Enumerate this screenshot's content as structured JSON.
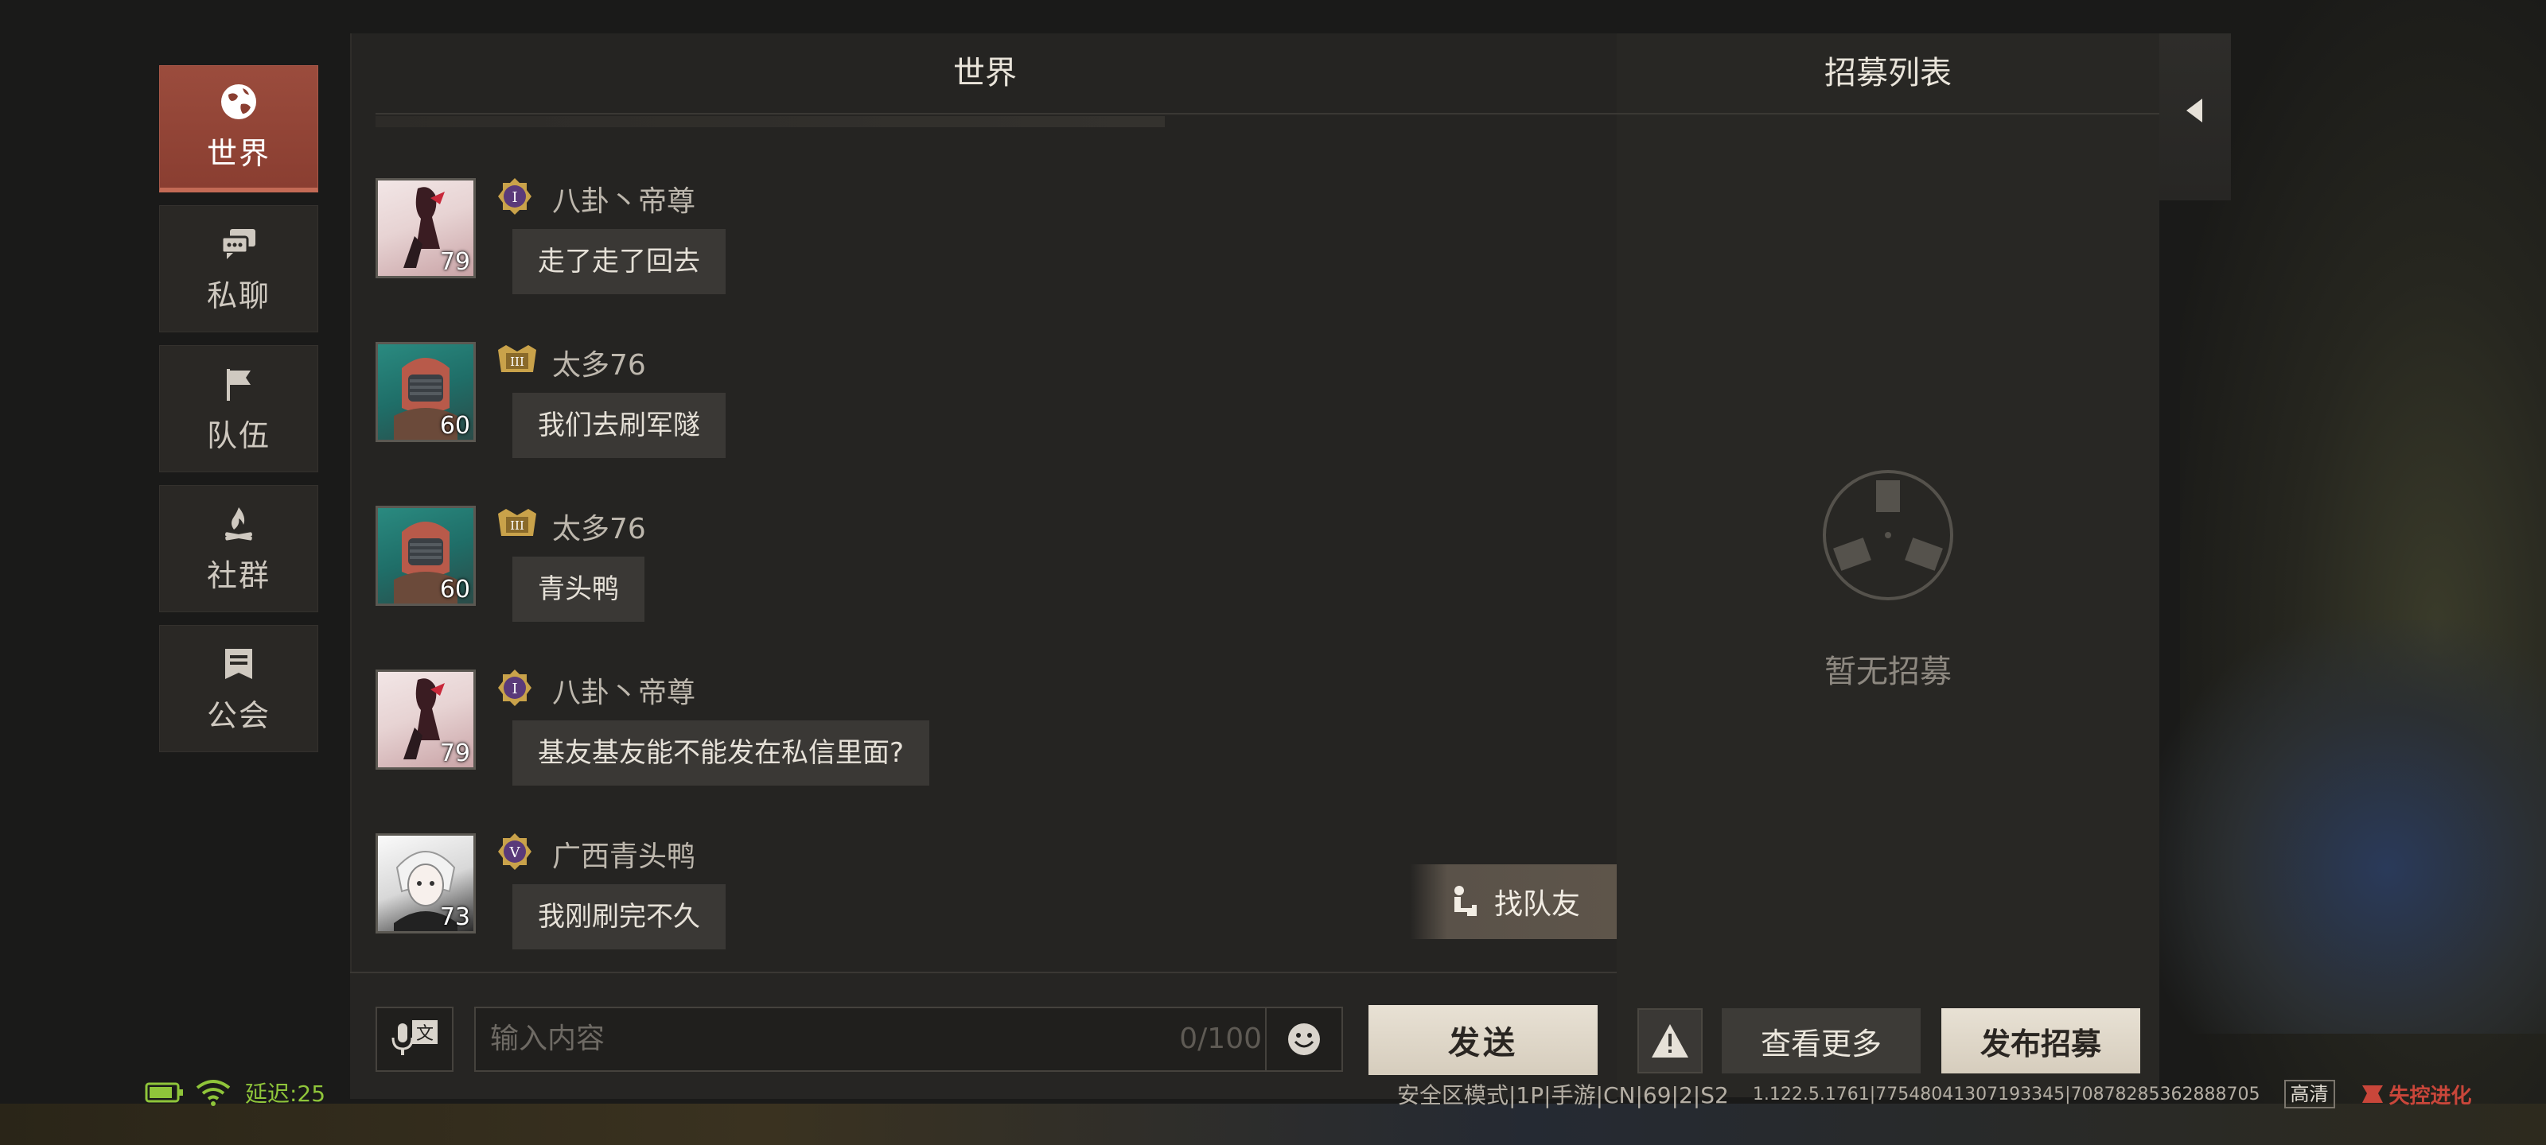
{
  "nav": {
    "items": [
      {
        "label": "世界",
        "icon": "globe-icon",
        "active": true
      },
      {
        "label": "私聊",
        "icon": "chat-bubbles-icon",
        "active": false
      },
      {
        "label": "队伍",
        "icon": "flag-icon",
        "active": false
      },
      {
        "label": "社群",
        "icon": "campfire-icon",
        "active": false
      },
      {
        "label": "公会",
        "icon": "guild-banner-icon",
        "active": false
      }
    ]
  },
  "chat": {
    "title": "世界",
    "messages": [
      {
        "user": "八卦丶帝尊",
        "level": "79",
        "badge": "I",
        "text": "走了走了回去"
      },
      {
        "user": "太多76",
        "level": "60",
        "badge": "III",
        "text": "我们去刷军隧"
      },
      {
        "user": "太多76",
        "level": "60",
        "badge": "III",
        "text": "青头鸭"
      },
      {
        "user": "八卦丶帝尊",
        "level": "79",
        "badge": "I",
        "text": "基友基友能不能发在私信里面?"
      },
      {
        "user": "广西青头鸭",
        "level": "73",
        "badge": "V",
        "text": "我刚刷完不久"
      }
    ],
    "find_teammate_label": "找队友",
    "input": {
      "placeholder": "输入内容",
      "counter": "0/100"
    },
    "send_label": "发送"
  },
  "recruit": {
    "title": "招募列表",
    "empty_text": "暂无招募",
    "more_label": "查看更多",
    "publish_label": "发布招募"
  },
  "status": {
    "latency": "延迟:25",
    "server_info": "安全区模式|1P|手游|CN|69|2|S2",
    "version": "1.122.5.1761|77548041307193345|70878285362888705",
    "quality": "高清",
    "logo_text": "失控进化"
  },
  "colors": {
    "accent_active": "#9b4c3d",
    "latency_green": "#8fc53a",
    "button_light": "#e8e1d4"
  }
}
